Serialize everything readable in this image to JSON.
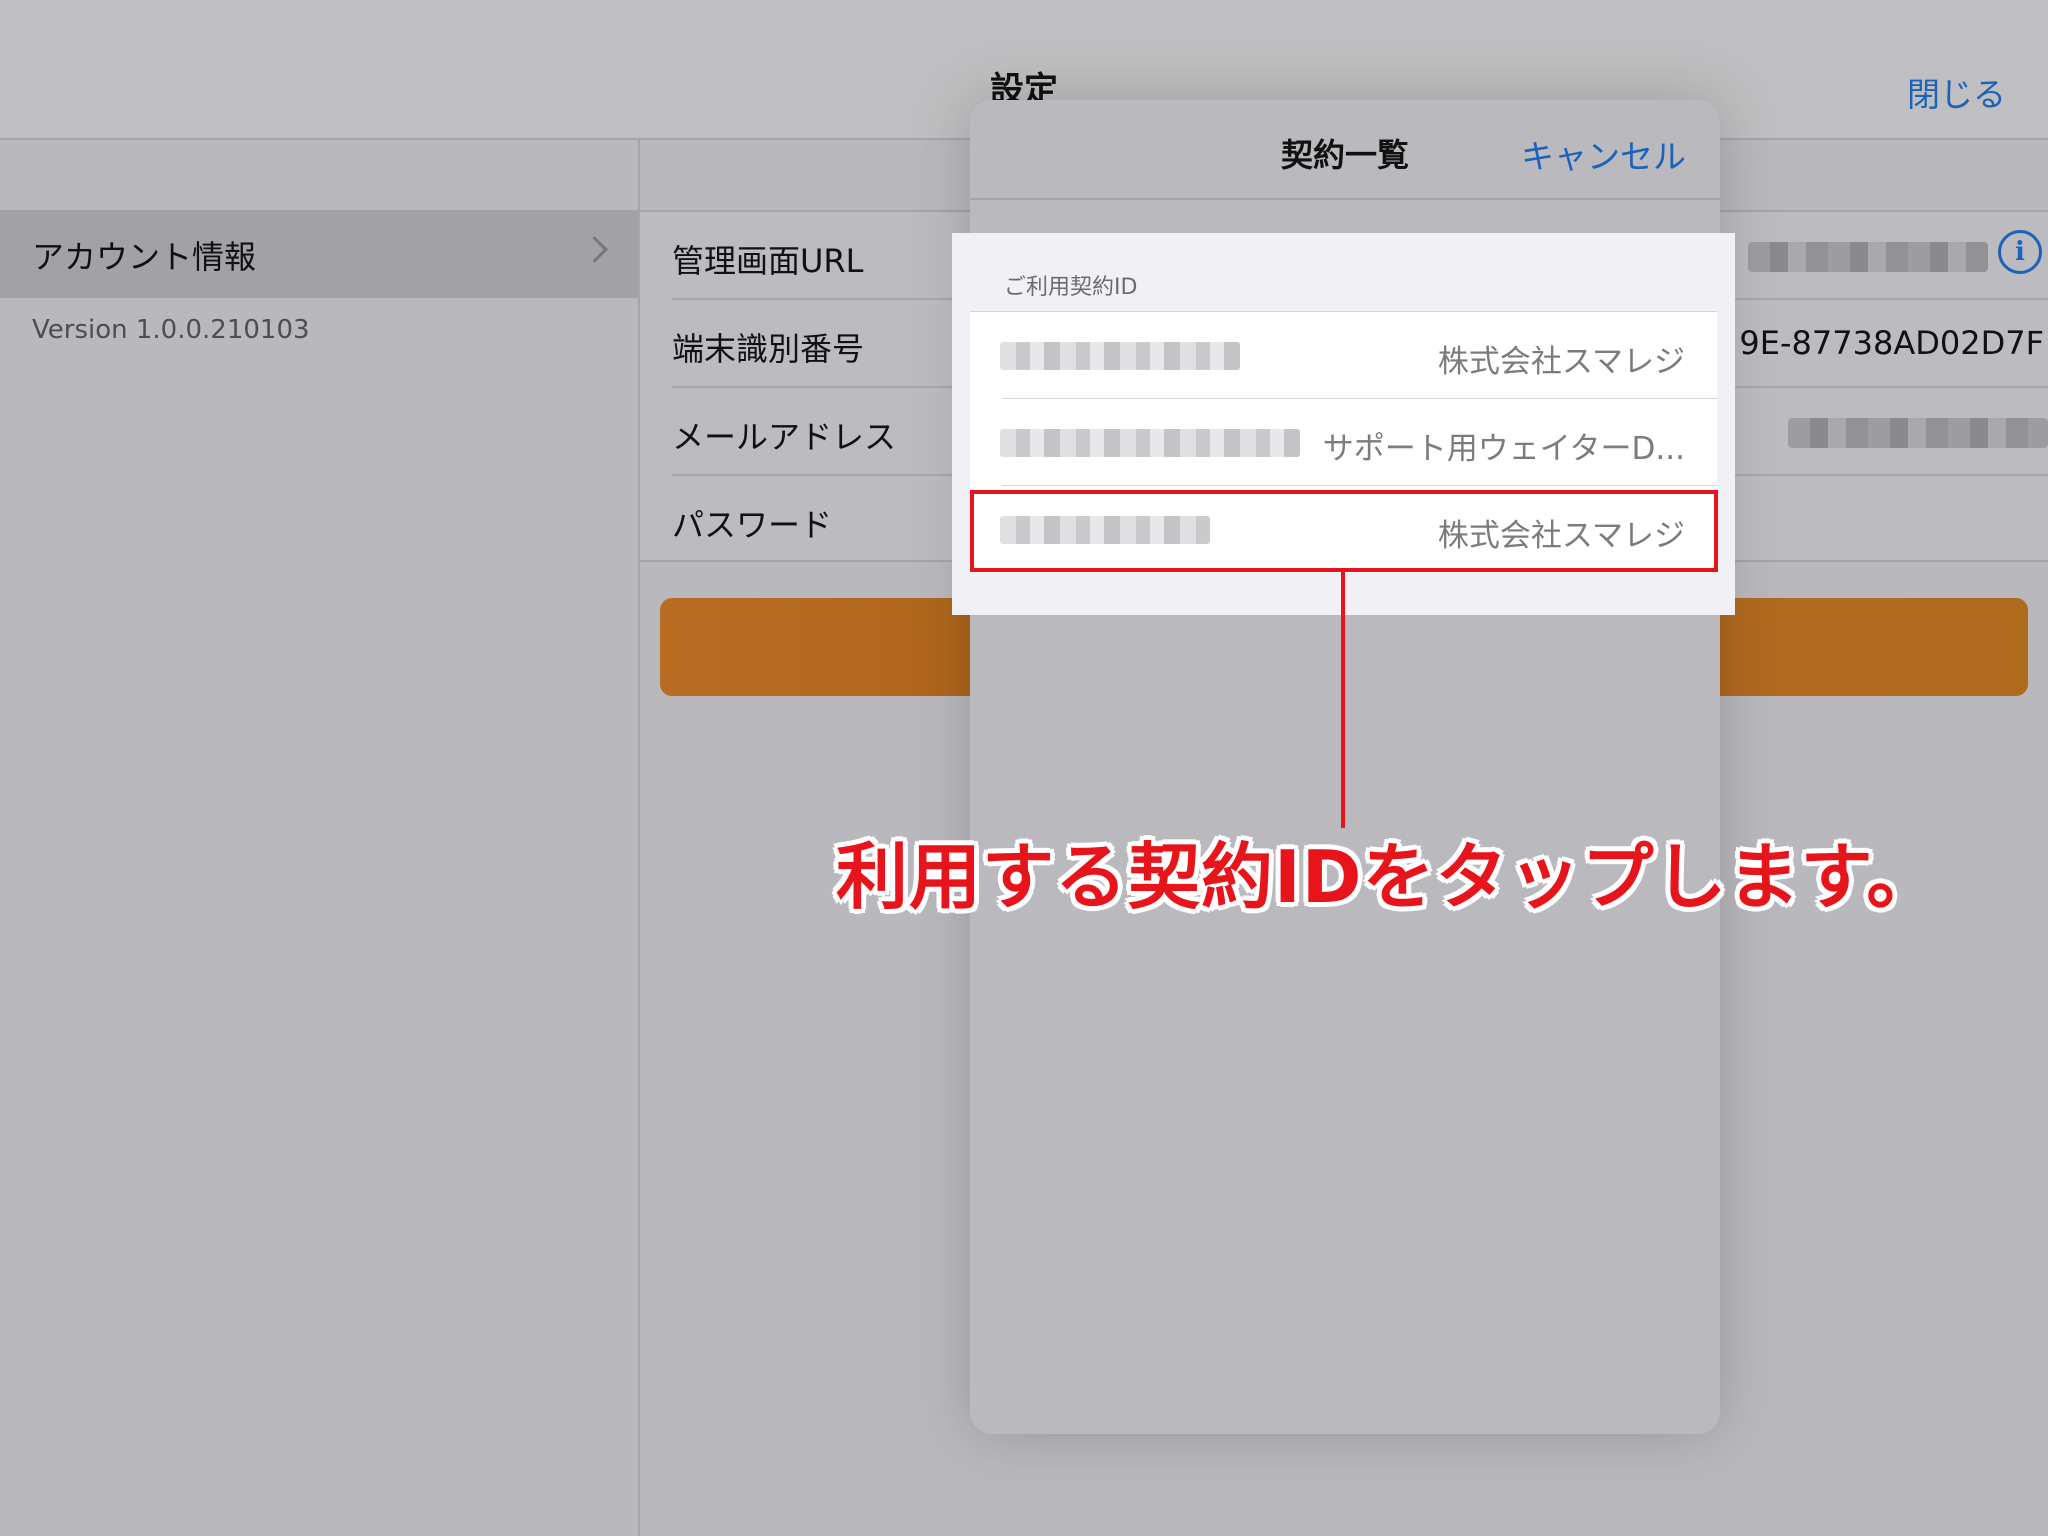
{
  "navbar": {
    "title": "設定",
    "close_label": "閉じる"
  },
  "sidebar": {
    "items": [
      {
        "label": "アカウント情報"
      }
    ],
    "version": "Version 1.0.0.210103"
  },
  "detail": {
    "rows": [
      {
        "label": "管理画面URL",
        "value": ""
      },
      {
        "label": "端末識別番号",
        "value": "9E-87738AD02D7F"
      },
      {
        "label": "メールアドレス",
        "value": ""
      },
      {
        "label": "パスワード",
        "value": ""
      }
    ]
  },
  "modal": {
    "title": "契約一覧",
    "cancel_label": "キャンセル",
    "section_header": "ご利用契約ID",
    "contracts": [
      {
        "company": "株式会社スマレジ"
      },
      {
        "company": "サポート用ウェイターD..."
      },
      {
        "company": "株式会社スマレジ"
      }
    ]
  },
  "annotation": {
    "text": "利用する契約IDをタップします。",
    "color": "#e8141c"
  },
  "colors": {
    "accent": "#1a63b8",
    "button": "#b06a1e",
    "highlight": "#e8141c"
  }
}
